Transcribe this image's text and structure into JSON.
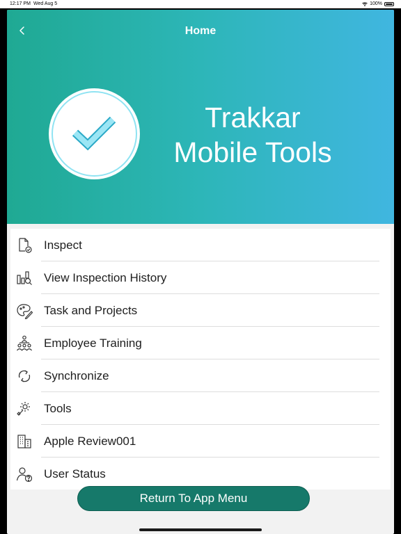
{
  "status_bar": {
    "time": "12:17 PM",
    "date": "Wed Aug 5",
    "battery": "100%"
  },
  "nav": {
    "title": "Home"
  },
  "hero": {
    "brand_line1": "Trakkar",
    "brand_line2": "Mobile Tools"
  },
  "menu": [
    {
      "label": "Inspect",
      "icon": "inspect-document-icon"
    },
    {
      "label": "View Inspection History",
      "icon": "chart-search-icon"
    },
    {
      "label": "Task and Projects",
      "icon": "palette-pencil-icon"
    },
    {
      "label": "Employee Training",
      "icon": "people-group-icon"
    },
    {
      "label": "Synchronize",
      "icon": "sync-icon"
    },
    {
      "label": "Tools",
      "icon": "gear-wrench-icon"
    },
    {
      "label": "Apple Review001",
      "icon": "building-icon"
    },
    {
      "label": "User Status",
      "icon": "user-question-icon"
    }
  ],
  "footer": {
    "button_label": "Return To App Menu"
  },
  "colors": {
    "hero_start": "#1fa993",
    "hero_end": "#40b6e0",
    "button": "#16796a"
  }
}
